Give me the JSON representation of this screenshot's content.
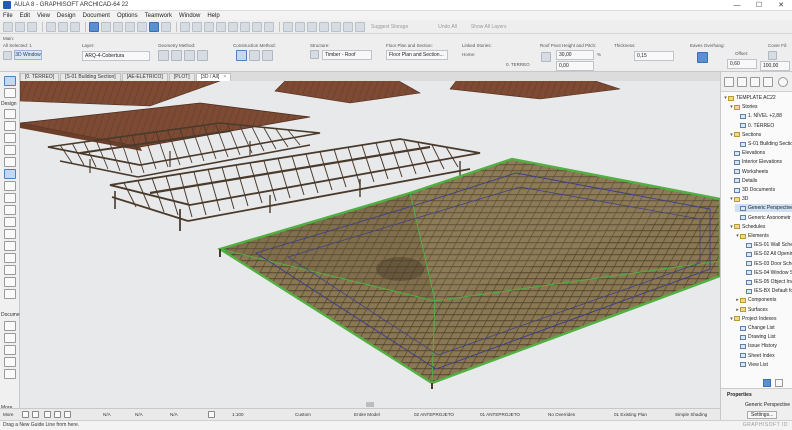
{
  "window": {
    "title": "AULA 8 - GRAPHISOFT ARCHICAD-64 22",
    "controls": [
      "—",
      "☐",
      "✕"
    ]
  },
  "menu": [
    "File",
    "Edit",
    "View",
    "Design",
    "Document",
    "Options",
    "Teamwork",
    "Window",
    "Help"
  ],
  "toolbar": {
    "suggest_storage": "Suggest Storage",
    "undo_all": "Undo All",
    "show_all_layers": "Show All Layers"
  },
  "infobox": {
    "main_label": "Main:",
    "all_selected": "All Selected: 1",
    "view_button": "3D Window",
    "layer_label": "Layer:",
    "layer_value": "ARQ-4-Cobertura",
    "geometry_label": "Geometry Method:",
    "construction_label": "Construction Method:",
    "structure_label": "Structure:",
    "structure_value": "Timber - Roof",
    "floor_plan_label": "Floor Plan and Section:",
    "floor_plan_value": "Floor Plan and Section...",
    "linked_stories_label": "Linked Stories:",
    "home_label": "Home:",
    "home_value": "0. TERREO",
    "pivot_label": "Roof Pivot Height and Pitch:",
    "pivot_height": "30,00",
    "pivot_unit": "%",
    "pivot_pitch": "0,00",
    "thickness_label": "Thickness:",
    "thickness_value": "0,15",
    "eaves_label": "Eaves Overhang:",
    "offset_label": "Offset:",
    "offset_value": "0,60",
    "cover_label": "Cover Fil:",
    "cover_value": "100,00"
  },
  "toolbox": {
    "groups": [
      "Select",
      "Design",
      "Docume",
      "More"
    ]
  },
  "tabs": [
    {
      "label": "[0. TÉRREO]",
      "active": false
    },
    {
      "label": "[S-01 Building Section]",
      "active": false
    },
    {
      "label": "[AE-ELÉTRICO]",
      "active": false
    },
    {
      "label": "[PLOT]",
      "active": false
    },
    {
      "label": "[3D / All]",
      "active": true
    }
  ],
  "navigator": {
    "items": [
      {
        "label": "TEMPLATE AC22",
        "level": 0,
        "type": "folder",
        "arrow": "▾"
      },
      {
        "label": "Stories",
        "level": 1,
        "type": "folder",
        "arrow": "▾"
      },
      {
        "label": "1. NÍVEL +2,88",
        "level": 2,
        "type": "view",
        "arrow": ""
      },
      {
        "label": "0. TÉRREO",
        "level": 2,
        "type": "view",
        "arrow": ""
      },
      {
        "label": "Sections",
        "level": 1,
        "type": "folder",
        "arrow": "▾"
      },
      {
        "label": "S-01 Building Sectio",
        "level": 2,
        "type": "view",
        "arrow": ""
      },
      {
        "label": "Elevations",
        "level": 1,
        "type": "view",
        "arrow": ""
      },
      {
        "label": "Interior Elevations",
        "level": 1,
        "type": "view",
        "arrow": ""
      },
      {
        "label": "Worksheets",
        "level": 1,
        "type": "view",
        "arrow": ""
      },
      {
        "label": "Details",
        "level": 1,
        "type": "view",
        "arrow": ""
      },
      {
        "label": "3D Documents",
        "level": 1,
        "type": "view",
        "arrow": ""
      },
      {
        "label": "3D",
        "level": 1,
        "type": "folder",
        "arrow": "▾"
      },
      {
        "label": "Generic Perspective",
        "level": 2,
        "type": "view",
        "arrow": "",
        "selected": true
      },
      {
        "label": "Generic Axonometr",
        "level": 2,
        "type": "view",
        "arrow": ""
      },
      {
        "label": "Schedules",
        "level": 1,
        "type": "folder",
        "arrow": "▾"
      },
      {
        "label": "Elements",
        "level": 2,
        "type": "folder",
        "arrow": "▾"
      },
      {
        "label": "IES-01 Wall Sched",
        "level": 3,
        "type": "view",
        "arrow": ""
      },
      {
        "label": "IES-02 All Openin",
        "level": 3,
        "type": "view",
        "arrow": ""
      },
      {
        "label": "IES-03 Door Sche",
        "level": 3,
        "type": "view",
        "arrow": ""
      },
      {
        "label": "IES-04 Window Sc",
        "level": 3,
        "type": "view",
        "arrow": ""
      },
      {
        "label": "IES-05 Object Inv",
        "level": 3,
        "type": "view",
        "arrow": ""
      },
      {
        "label": "IES-BX Default fo",
        "level": 3,
        "type": "view",
        "arrow": ""
      },
      {
        "label": "Components",
        "level": 2,
        "type": "folder",
        "arrow": "▸"
      },
      {
        "label": "Surfaces",
        "level": 2,
        "type": "folder",
        "arrow": "▸"
      },
      {
        "label": "Project Indexes",
        "level": 1,
        "type": "folder",
        "arrow": "▾"
      },
      {
        "label": "Change List",
        "level": 2,
        "type": "view",
        "arrow": ""
      },
      {
        "label": "Drawing List",
        "level": 2,
        "type": "view",
        "arrow": ""
      },
      {
        "label": "Issue History",
        "level": 2,
        "type": "view",
        "arrow": ""
      },
      {
        "label": "Sheet Index",
        "level": 2,
        "type": "view",
        "arrow": ""
      },
      {
        "label": "View List",
        "level": 2,
        "type": "view",
        "arrow": ""
      }
    ],
    "properties_label": "Properties",
    "properties_value": "Generic Perspective",
    "settings_label": "Settings..."
  },
  "statusbar": {
    "na1": "N/A",
    "na2": "N/A",
    "na3": "N/A",
    "scale": "1:100",
    "custom": "Custom",
    "model": "Entire Model",
    "layer_combo": "02 ANTEPROJETO",
    "pen_set": "01 ANTEPROJETO",
    "overrides": "No Overrides",
    "renovation": "01 Existing Plan",
    "shading": "Simple Shading"
  },
  "message": "Drag a New Guide Line from here.",
  "brand": "GRAPHISOFT ID"
}
